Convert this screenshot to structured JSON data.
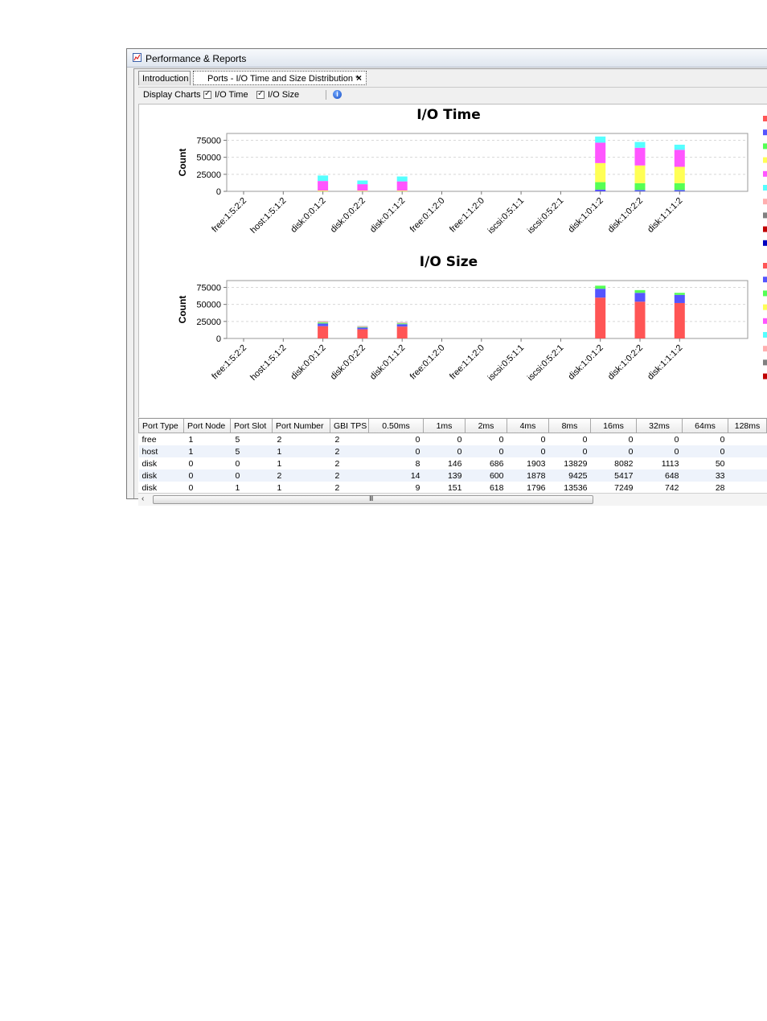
{
  "window": {
    "title": "Performance & Reports"
  },
  "tabs": [
    {
      "label": "Introduction"
    },
    {
      "label": "Ports - I/O Time and Size Distribution *",
      "close": "×"
    }
  ],
  "toolbar": {
    "display_charts_label": "Display Charts",
    "io_time_label": "I/O Time",
    "io_size_label": "I/O Size",
    "io_time_checked": true,
    "io_size_checked": true,
    "info_icon": "i"
  },
  "chart_data": [
    {
      "type": "bar",
      "stacked": true,
      "title": "I/O Time",
      "ylabel": "Count",
      "xlabel": "",
      "ylim": [
        0,
        85000
      ],
      "yticks": [
        0,
        25000,
        50000,
        75000
      ],
      "grid": true,
      "categories": [
        "free:1:5:2:2",
        "host:1:5:1:2",
        "disk:0:0:1:2",
        "disk:0:0:2:2",
        "disk:0:1:1:2",
        "free:0:1:2:0",
        "free:1:1:2:0",
        "iscsi:0:5:1:1",
        "iscsi:0:5:2:1",
        "disk:1:0:1:2",
        "disk:1:0:2:2",
        "disk:1:1:1:2"
      ],
      "series": [
        {
          "color": "#5555ff",
          "values": [
            0,
            0,
            0,
            0,
            0,
            0,
            0,
            0,
            0,
            2500,
            2000,
            2000
          ]
        },
        {
          "color": "#55ff55",
          "values": [
            0,
            0,
            0,
            0,
            0,
            0,
            0,
            0,
            0,
            11000,
            10000,
            10000
          ]
        },
        {
          "color": "#ffff55",
          "values": [
            0,
            0,
            1200,
            1000,
            1100,
            0,
            0,
            0,
            0,
            28000,
            26000,
            24000
          ]
        },
        {
          "color": "#ff55ff",
          "values": [
            0,
            0,
            14000,
            9500,
            13500,
            0,
            0,
            0,
            0,
            30000,
            26000,
            25000
          ]
        },
        {
          "color": "#55ffff",
          "values": [
            0,
            0,
            8000,
            5400,
            7200,
            0,
            0,
            0,
            0,
            9000,
            8500,
            7500
          ]
        }
      ],
      "legend_colors": [
        "#ff5555",
        "#5555ff",
        "#55ff55",
        "#ffff55",
        "#ff55ff",
        "#55ffff",
        "#ffafaf",
        "#808080",
        "#c00000",
        "#0000c0"
      ]
    },
    {
      "type": "bar",
      "stacked": true,
      "title": "I/O Size",
      "ylabel": "Count",
      "xlabel": "",
      "ylim": [
        0,
        85000
      ],
      "yticks": [
        0,
        25000,
        50000,
        75000
      ],
      "grid": true,
      "categories": [
        "free:1:5:2:2",
        "host:1:5:1:2",
        "disk:0:0:1:2",
        "disk:0:0:2:2",
        "disk:0:1:1:2",
        "free:0:1:2:0",
        "free:1:1:2:0",
        "iscsi:0:5:1:1",
        "iscsi:0:5:2:1",
        "disk:1:0:1:2",
        "disk:1:0:2:2",
        "disk:1:1:1:2"
      ],
      "series": [
        {
          "color": "#ff5555",
          "values": [
            0,
            0,
            18000,
            13500,
            17500,
            0,
            0,
            0,
            0,
            60000,
            54000,
            52000
          ]
        },
        {
          "color": "#5555ff",
          "values": [
            0,
            0,
            4000,
            2500,
            3500,
            0,
            0,
            0,
            0,
            13000,
            13000,
            12000
          ]
        },
        {
          "color": "#55ff55",
          "values": [
            0,
            0,
            1500,
            900,
            1200,
            0,
            0,
            0,
            0,
            4500,
            4000,
            3000
          ]
        },
        {
          "color": "#ffafaf",
          "values": [
            0,
            0,
            1200,
            800,
            1000,
            0,
            0,
            0,
            0,
            0,
            0,
            0
          ]
        },
        {
          "color": "#b0b0b0",
          "values": [
            0,
            0,
            800,
            600,
            700,
            0,
            0,
            0,
            0,
            0,
            0,
            0
          ]
        }
      ],
      "legend_colors": [
        "#ff5555",
        "#5555ff",
        "#55ff55",
        "#ffff55",
        "#ff55ff",
        "#55ffff",
        "#ffafaf",
        "#808080",
        "#c00000"
      ]
    }
  ],
  "table": {
    "columns": [
      "Port Type",
      "Port Node",
      "Port Slot",
      "Port Number",
      "GBI TPS",
      "0.50ms",
      "1ms",
      "2ms",
      "4ms",
      "8ms",
      "16ms",
      "32ms",
      "64ms",
      "128ms"
    ],
    "rows": [
      [
        "free",
        "1",
        "5",
        "2",
        "2",
        "0",
        "0",
        "0",
        "0",
        "0",
        "0",
        "0",
        "0",
        ""
      ],
      [
        "host",
        "1",
        "5",
        "1",
        "2",
        "0",
        "0",
        "0",
        "0",
        "0",
        "0",
        "0",
        "0",
        ""
      ],
      [
        "disk",
        "0",
        "0",
        "1",
        "2",
        "8",
        "146",
        "686",
        "1903",
        "13829",
        "8082",
        "1113",
        "50",
        ""
      ],
      [
        "disk",
        "0",
        "0",
        "2",
        "2",
        "14",
        "139",
        "600",
        "1878",
        "9425",
        "5417",
        "648",
        "33",
        ""
      ],
      [
        "disk",
        "0",
        "1",
        "1",
        "2",
        "9",
        "151",
        "618",
        "1796",
        "13536",
        "7249",
        "742",
        "28",
        ""
      ]
    ]
  },
  "scrollbar": {
    "left_arrow": "‹",
    "grip": "III"
  }
}
